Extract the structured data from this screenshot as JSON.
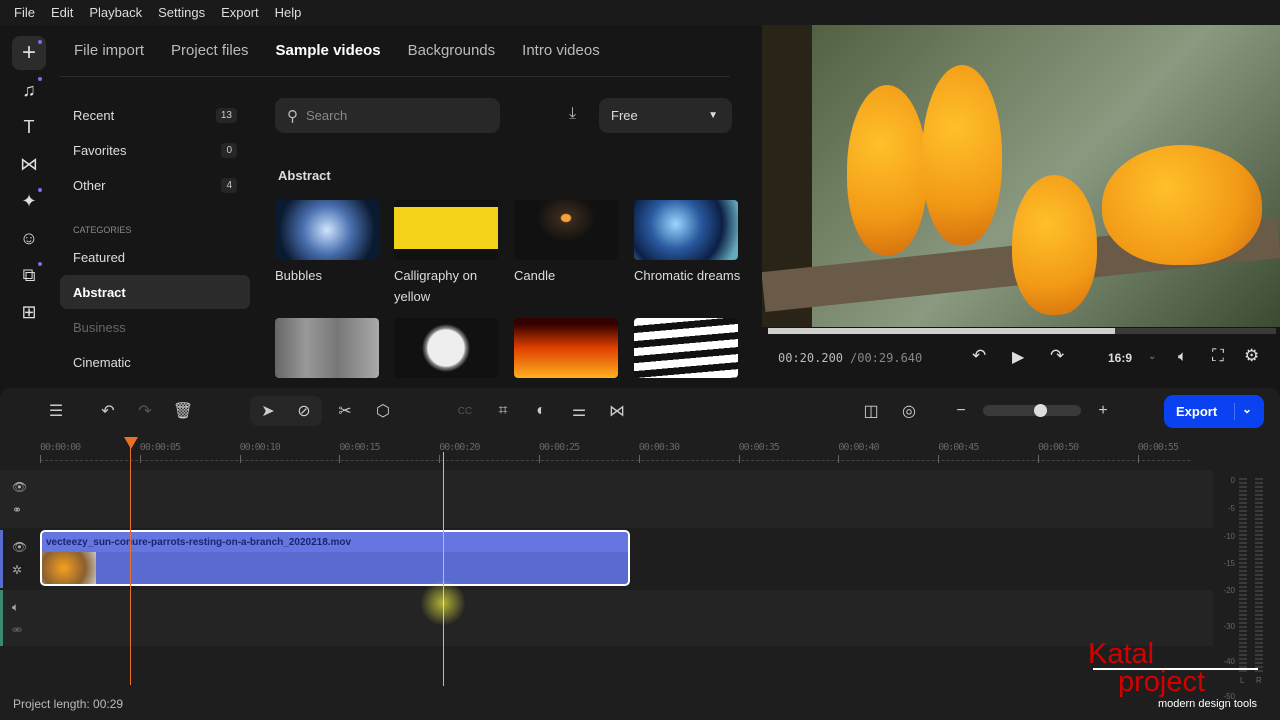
{
  "menu": [
    "File",
    "Edit",
    "Playback",
    "Settings",
    "Export",
    "Help"
  ],
  "rail": [
    "plus-icon",
    "music-icon",
    "text-icon",
    "transition-icon",
    "effects-icon",
    "sticker-icon",
    "overlay-icon",
    "apps-icon"
  ],
  "tabs": [
    "File import",
    "Project files",
    "Sample videos",
    "Backgrounds",
    "Intro videos"
  ],
  "selected_tab": "Sample videos",
  "sidebar": {
    "items": [
      {
        "label": "Recent",
        "count": "13"
      },
      {
        "label": "Favorites",
        "count": "0"
      },
      {
        "label": "Other",
        "count": "4"
      }
    ],
    "categories_label": "CATEGORIES",
    "categories": [
      "Featured",
      "Abstract",
      "Business",
      "Cinematic"
    ],
    "selected": "Abstract"
  },
  "search": {
    "placeholder": "Search"
  },
  "filter": {
    "value": "Free"
  },
  "section": "Abstract",
  "thumbs": [
    {
      "label": "Bubbles"
    },
    {
      "label": "Calligraphy on yellow"
    },
    {
      "label": "Candle"
    },
    {
      "label": "Chromatic dreams"
    },
    {
      "label": ""
    },
    {
      "label": ""
    },
    {
      "label": ""
    },
    {
      "label": ""
    }
  ],
  "player": {
    "time_current": "00:20.200",
    "time_total": "/00:29.640",
    "progress": 0.684,
    "aspect": "16:9"
  },
  "timeline": {
    "ticks": [
      "00:00:00",
      "00:00:05",
      "00:00:10",
      "00:00:15",
      "00:00:20",
      "00:00:25",
      "00:00:30",
      "00:00:35",
      "00:00:40",
      "00:00:45",
      "00:00:50",
      "00:00:55"
    ],
    "clip_name": "vecteezy_sun-conure-parrots-resting-on-a-branch_2020218.mov",
    "zoom_level": 0.6,
    "project_length": "Project length: 00:29"
  },
  "export_label": "Export",
  "meter": {
    "labels": [
      "0",
      "-5",
      "-10",
      "-15",
      "-20",
      "-30",
      "-40",
      "-50"
    ],
    "channels": [
      "L",
      "R"
    ]
  },
  "watermark": {
    "line1": "Katal",
    "line2": "project",
    "tagline": "modern design tools"
  },
  "colors": {
    "accent": "#0a41f0",
    "clip": "#5a6bd0",
    "playhead": "#e8702a",
    "brand": "#d40000"
  }
}
